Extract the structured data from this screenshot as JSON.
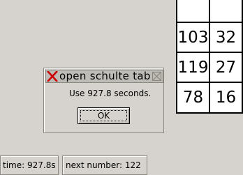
{
  "grid": {
    "cells": [
      "",
      "",
      "103",
      "32",
      "119",
      "27",
      "78",
      "16"
    ]
  },
  "dialog": {
    "title": "open schulte table",
    "close_icon": "close-x-icon",
    "maximize_icon": "maximize-icon",
    "message": "Use 927.8 seconds.",
    "ok_label": "OK"
  },
  "status": {
    "time": "time: 927.8s",
    "next": "next number: 122"
  },
  "colors": {
    "background": "#d6d3ce",
    "close_x": "#cc0000"
  }
}
